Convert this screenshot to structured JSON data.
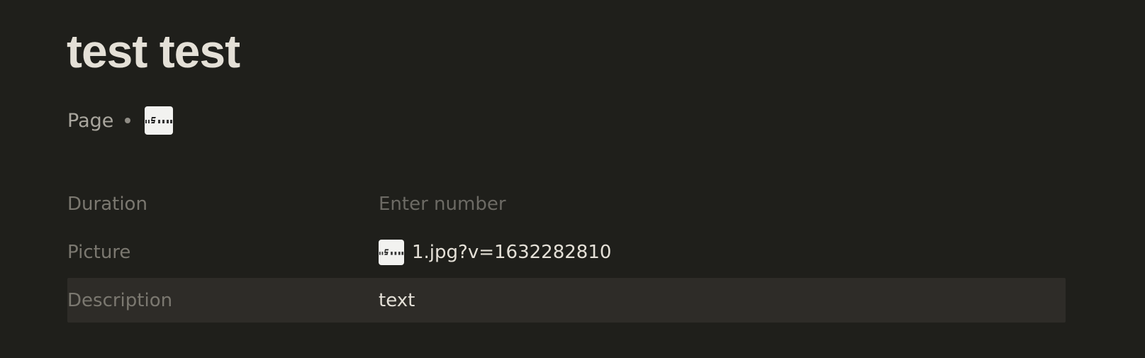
{
  "page": {
    "title": "test test",
    "type_label": "Page",
    "icon": "image-thumbnail-icon"
  },
  "properties": [
    {
      "label": "Duration",
      "placeholder": "Enter number",
      "value": ""
    },
    {
      "label": "Picture",
      "value": "1.jpg?v=1632282810",
      "icon": "image-thumbnail-icon"
    },
    {
      "label": "Description",
      "value": "text"
    }
  ],
  "colors": {
    "background": "#1f1f1b",
    "row_highlight": "#2e2c28",
    "title_text": "#e4e0d7",
    "label_text": "#7b7870",
    "placeholder_text": "#6c6a64"
  }
}
